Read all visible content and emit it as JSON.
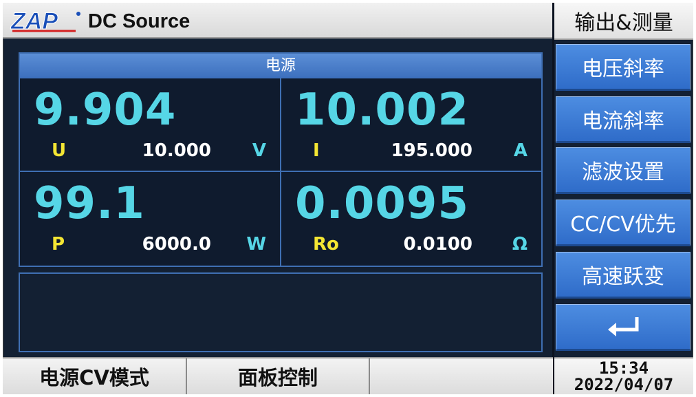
{
  "header": {
    "app_title": "DC Source",
    "logo_text": "ZAP",
    "section_title": "输出&测量"
  },
  "panel": {
    "title": "电源",
    "voltage": {
      "measured": "9.904",
      "label": "U",
      "set": "10.000",
      "unit": "V"
    },
    "current": {
      "measured": "10.002",
      "label": "I",
      "set": "195.000",
      "unit": "A"
    },
    "power": {
      "measured": "99.1",
      "label": "P",
      "set": "6000.0",
      "unit": "W"
    },
    "resistance": {
      "measured": "0.0095",
      "label": "Ro",
      "set": "0.0100",
      "unit": "Ω"
    }
  },
  "menu": {
    "items": [
      {
        "label": "电压斜率"
      },
      {
        "label": "电流斜率"
      },
      {
        "label": "滤波设置"
      },
      {
        "label": "CC/CV优先"
      },
      {
        "label": "高速跃变"
      }
    ],
    "return_icon": "return-arrow-icon"
  },
  "status": {
    "mode": "电源CV模式",
    "control": "面板控制",
    "extra": "",
    "time": "15:34",
    "date": "2022/04/07"
  },
  "colors": {
    "background": "#132033",
    "measured": "#56d6e6",
    "label": "#f4e633",
    "button": "#3b7bd6",
    "border": "#3f6fb3"
  }
}
